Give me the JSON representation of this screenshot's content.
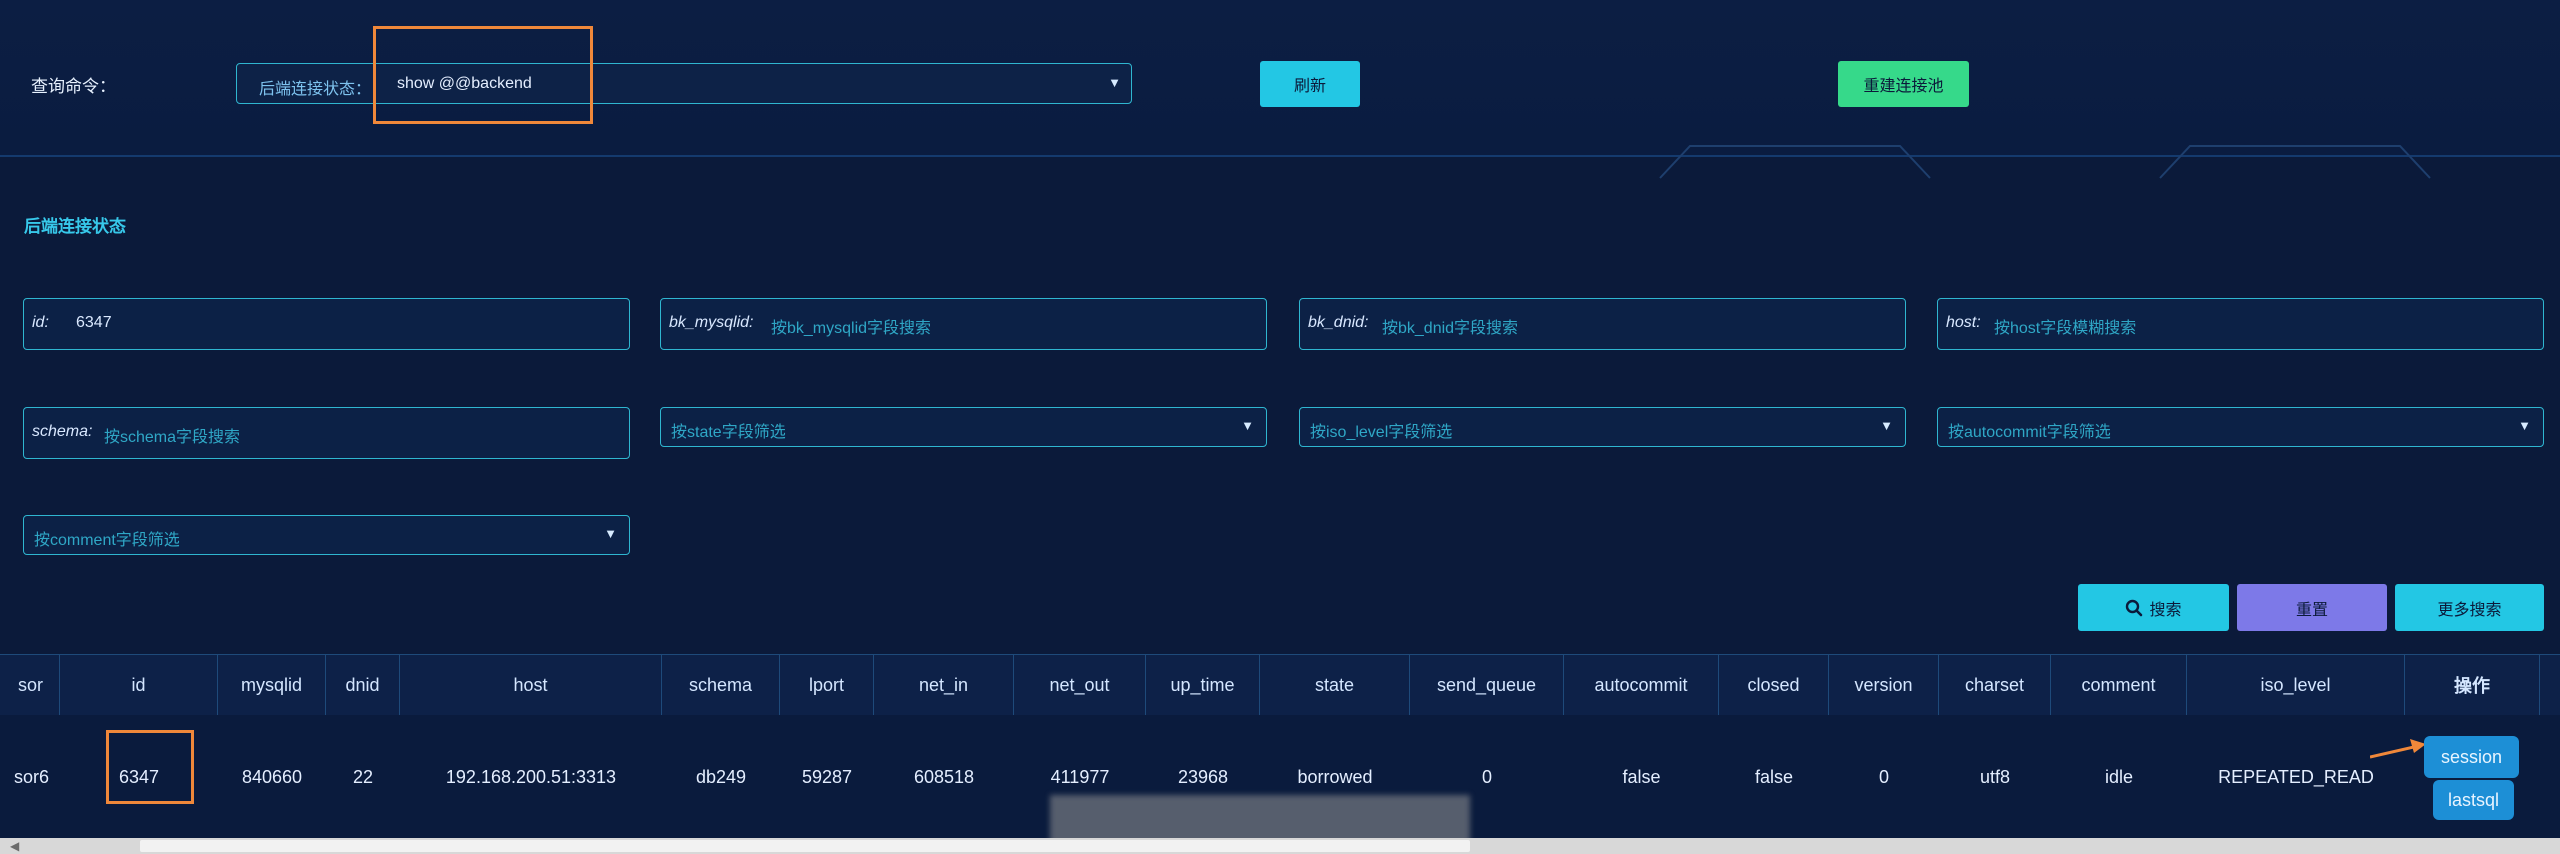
{
  "query": {
    "label": "查询命令：",
    "select_prefix": "后端连接状态：",
    "select_value": "show @@backend",
    "refresh_label": "刷新",
    "rebuild_label": "重建连接池"
  },
  "section": {
    "title": "后端连接状态"
  },
  "filters": [
    {
      "label": "id:",
      "value": "6347"
    },
    {
      "label": "bk_mysqlid:",
      "placeholder": "按bk_mysqlid字段搜索"
    },
    {
      "label": "bk_dnid:",
      "placeholder": "按bk_dnid字段搜索"
    },
    {
      "label": "host:",
      "placeholder": "按host字段模糊搜索"
    },
    {
      "label": "schema:",
      "placeholder": "按schema字段搜索"
    },
    {
      "placeholder": "按state字段筛选"
    },
    {
      "placeholder": "按iso_level字段筛选"
    },
    {
      "placeholder": "按autocommit字段筛选"
    },
    {
      "placeholder": "按comment字段筛选"
    }
  ],
  "actions": {
    "search": "搜索",
    "reset": "重置",
    "more": "更多搜索"
  },
  "table": {
    "columns": [
      "sor",
      "id",
      "mysqlid",
      "dnid",
      "host",
      "schema",
      "lport",
      "net_in",
      "net_out",
      "up_time",
      "state",
      "send_queue",
      "autocommit",
      "closed",
      "version",
      "charset",
      "comment",
      "iso_level",
      "操作"
    ],
    "row": [
      "sor6",
      "6347",
      "840660",
      "22",
      "192.168.200.51:3313",
      "db249",
      "59287",
      "608518",
      "411977",
      "23968",
      "borrowed",
      "0",
      "false",
      "false",
      "0",
      "utf8",
      "idle",
      "REPEATED_READ"
    ],
    "row_actions": [
      "session",
      "lastsql"
    ]
  },
  "colors": {
    "accent": "#23c7e4",
    "success": "#36d98a",
    "purple": "#7d79e8",
    "highlight": "#f0883a"
  }
}
